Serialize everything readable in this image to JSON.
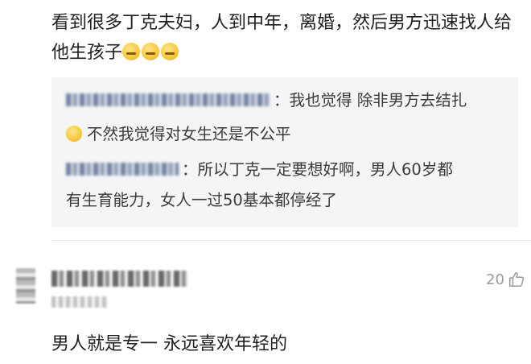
{
  "post": {
    "text": "看到很多丁克夫妇，人到中年，离婚，然后男方迅速找人给他生孩子",
    "emoji_name": "awkward-face-icon"
  },
  "quote": {
    "line1_text": "：我也觉得 除非男方去结扎",
    "line2_text": "不然我觉得对女生还是不公平",
    "line3_text": "：所以丁克一定要想好啊，男人60岁都",
    "line4_text": "有生育能力，女人一过50基本都停经了"
  },
  "comment": {
    "likes": "20",
    "text": "男人就是专一 永远喜欢年轻的"
  },
  "colors": {
    "quote_bg": "#f5f5f7",
    "like_gray": "#9a9a9a"
  }
}
